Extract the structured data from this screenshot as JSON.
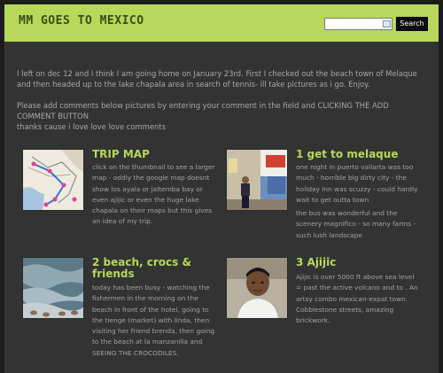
{
  "site": {
    "title": "MM GOES TO MEXICO"
  },
  "search": {
    "value": "",
    "placeholder": "",
    "button_label": "Search"
  },
  "intro": {
    "paragraph1": "I left on dec 12 and I think I am going home on January 23rd. First I checked out the beach town of Melaque and then headed up to the lake chapala area in search of tennis- ill take pictures as i go. Enjoy.",
    "paragraph2": "Please add comments below pictures by entering your comment in the field and CLICKING THE ADD COMMENT BUTTON",
    "paragraph3": "thanks cause i love love love comments"
  },
  "posts": [
    {
      "title": "TRIP MAP",
      "body": [
        "click on the thumbnail to see a larger map - oddly the google map doesnt show los ayala or jaltemba bay or even ajijic or even the huge lake chapala on their maps but this gives an idea of my trip."
      ]
    },
    {
      "title": "1 get to melaque",
      "body": [
        "one night in puerto vallarta was too much - horrible big dirty city - the holiday inn was scuzzy - could hardly wait to get outta town",
        "the bus was wonderful and the scenery magnifico - so many farms - such lush landscape"
      ]
    },
    {
      "title": "2 beach, crocs & friends",
      "body": [
        "today has been busy - watching the fishermen in the morning on the beach in front of the hotel, going to the tienge (market) with linda, then visiting her friend brenda, then going to the beach at la manzanilla and SEEING THE CROCODILES."
      ]
    },
    {
      "title": "3 Ajijic",
      "body": [
        "Ajijic is over 5000 ft above sea level = past the active volcano and to . An artsy combo mexican-expat town. Cobblestone streets, amazing brickwork."
      ]
    }
  ],
  "colors": {
    "accent": "#b7d85a",
    "page_bg": "#333333",
    "outer_bg": "#1c1c1c",
    "text": "#a8a8a8"
  }
}
